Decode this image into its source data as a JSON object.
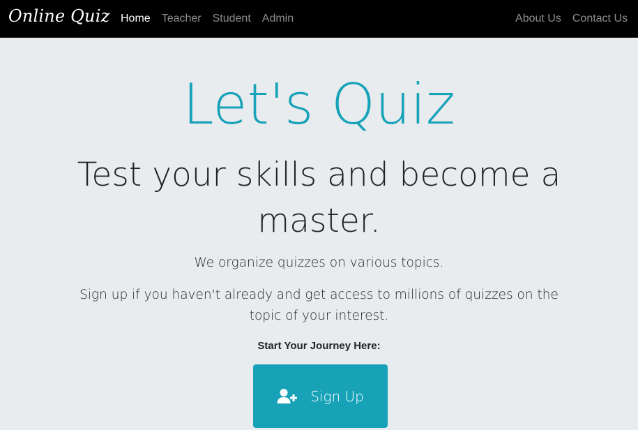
{
  "navbar": {
    "brand": "Online Quiz",
    "left_links": [
      {
        "label": "Home",
        "active": true
      },
      {
        "label": "Teacher",
        "active": false
      },
      {
        "label": "Student",
        "active": false
      },
      {
        "label": "Admin",
        "active": false
      }
    ],
    "right_links": [
      {
        "label": "About Us"
      },
      {
        "label": "Contact Us"
      }
    ]
  },
  "hero": {
    "title": "Let's Quiz",
    "subtitle": "Test your skills and become a master.",
    "lead_1": "We organize quizzes on various topics.",
    "lead_2": "Sign up if you haven't already and get access to millions of quizzes on the topic of your interest.",
    "journey_label": "Start Your Journey Here:",
    "signup_label": "Sign Up",
    "signup_icon": "user-plus-icon"
  },
  "colors": {
    "navbar_bg": "#000000",
    "page_bg": "#e9ecef",
    "accent": "#17a2b8",
    "text": "#212529"
  }
}
